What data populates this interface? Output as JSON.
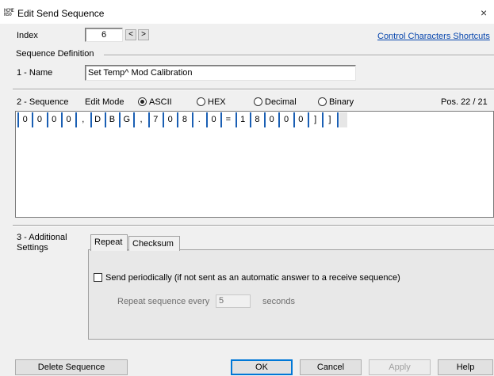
{
  "window": {
    "title": "Edit Send Sequence",
    "app_icon_text": "HCME\nNS0",
    "close_glyph": "×"
  },
  "index": {
    "label": "Index",
    "value": "6",
    "prev": "<",
    "next": ">"
  },
  "shortcuts_link": "Control Characters Shortcuts",
  "definition": {
    "group_label": "Sequence Definition",
    "name_label": "1 - Name",
    "name_value": "Set Temp^ Mod Calibration"
  },
  "sequence": {
    "label": "2 - Sequence",
    "edit_mode_label": "Edit Mode",
    "modes": [
      {
        "label": "ASCII",
        "checked": true
      },
      {
        "label": "HEX",
        "checked": false
      },
      {
        "label": "Decimal",
        "checked": false
      },
      {
        "label": "Binary",
        "checked": false
      }
    ],
    "pos": "Pos. 22 / 21",
    "chars": [
      "0",
      "0",
      "0",
      "0",
      ",",
      "D",
      "B",
      "G",
      ",",
      "7",
      "0",
      "8",
      ".",
      "0",
      "=",
      "1",
      "8",
      "0",
      "0",
      "0",
      "]",
      "]"
    ]
  },
  "additional": {
    "label": "3 - Additional Settings",
    "tabs": [
      {
        "label": "Repeat",
        "active": true
      },
      {
        "label": "Checksum",
        "active": false
      }
    ],
    "send_periodically": "Send periodically  (if not sent as an automatic answer to a receive sequence)",
    "repeat_every_label": "Repeat sequence every",
    "repeat_value": "5",
    "seconds_label": "seconds"
  },
  "buttons": {
    "delete": "Delete Sequence",
    "ok": "OK",
    "cancel": "Cancel",
    "apply": "Apply",
    "help": "Help"
  }
}
